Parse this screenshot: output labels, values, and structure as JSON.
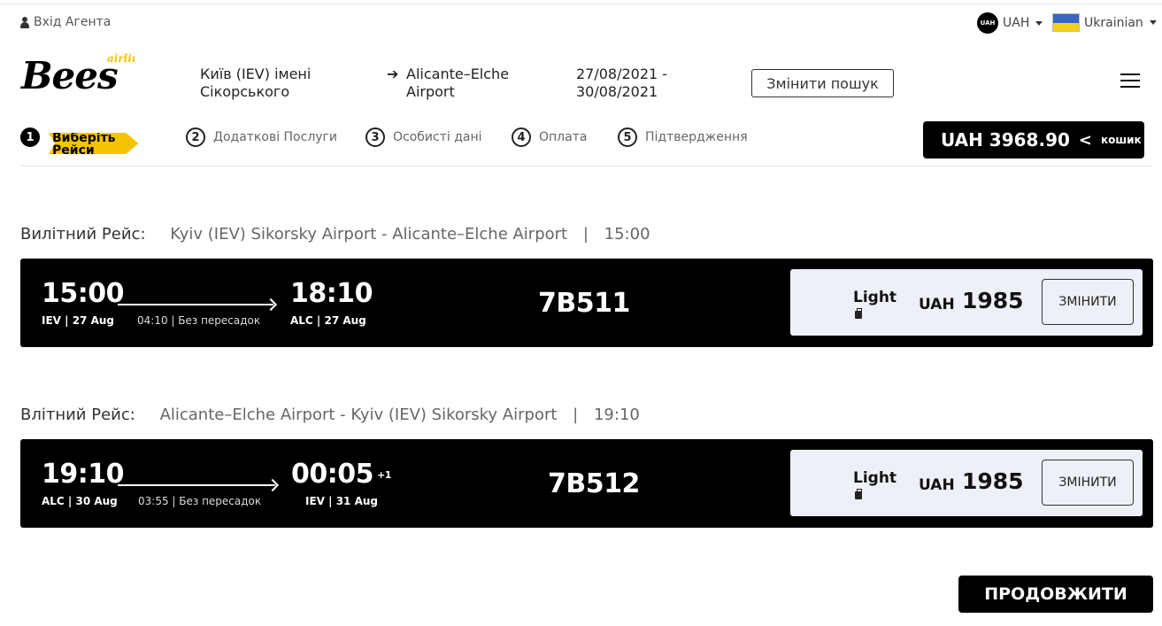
{
  "topbar": {
    "agent_login": "Вхід Агента",
    "currency_badge": "UAH",
    "currency": "UAH",
    "language": "Ukrainian"
  },
  "brand": {
    "logo_main": "Bees",
    "logo_sub": "airline",
    "accent": "#f5c400"
  },
  "search": {
    "from": "Київ (IEV) імені Сікорського",
    "arrow": "➔",
    "to": "Alicante–Elche Airport",
    "dates": "27/08/2021 - 30/08/2021",
    "change_label": "Змінити пошук"
  },
  "steps": [
    {
      "num": "1",
      "label": "Виберіть Рейси",
      "active": true
    },
    {
      "num": "2",
      "label": "Додаткові Послуги"
    },
    {
      "num": "3",
      "label": "Особисті дані"
    },
    {
      "num": "4",
      "label": "Оплата"
    },
    {
      "num": "5",
      "label": "Підтвердження"
    }
  ],
  "cart": {
    "amount": "UAH 3968.90",
    "chevron": "<",
    "label": "кошик"
  },
  "outbound": {
    "heading_label": "Вилітний Рейс:",
    "heading_route": "Kyiv (IEV) Sikorsky Airport - Alicante–Elche Airport",
    "heading_sep": "|",
    "heading_time": "15:00",
    "dep_time": "15:00",
    "dep_info": "IEV | 27 Aug",
    "duration": "04:10 | Без пересадок",
    "arr_time": "18:10",
    "arr_info": "ALC | 27 Aug",
    "flight_number": "7B511",
    "fare_name": "Light",
    "fare_currency": "UAH",
    "fare_amount": "1985",
    "change_label": "ЗМІНИТИ"
  },
  "inbound": {
    "heading_label": "Влітний Рейс:",
    "heading_route": "Alicante–Elche Airport - Kyiv (IEV) Sikorsky Airport",
    "heading_sep": "|",
    "heading_time": "19:10",
    "dep_time": "19:10",
    "dep_info": "ALC | 30 Aug",
    "duration": "03:55 | Без пересадок",
    "arr_time": "00:05",
    "arr_plus": "+1",
    "arr_info": "IEV | 31 Aug",
    "flight_number": "7B512",
    "fare_name": "Light",
    "fare_currency": "UAH",
    "fare_amount": "1985",
    "change_label": "ЗМІНИТИ"
  },
  "continue_label": "ПРОДОВЖИТИ"
}
